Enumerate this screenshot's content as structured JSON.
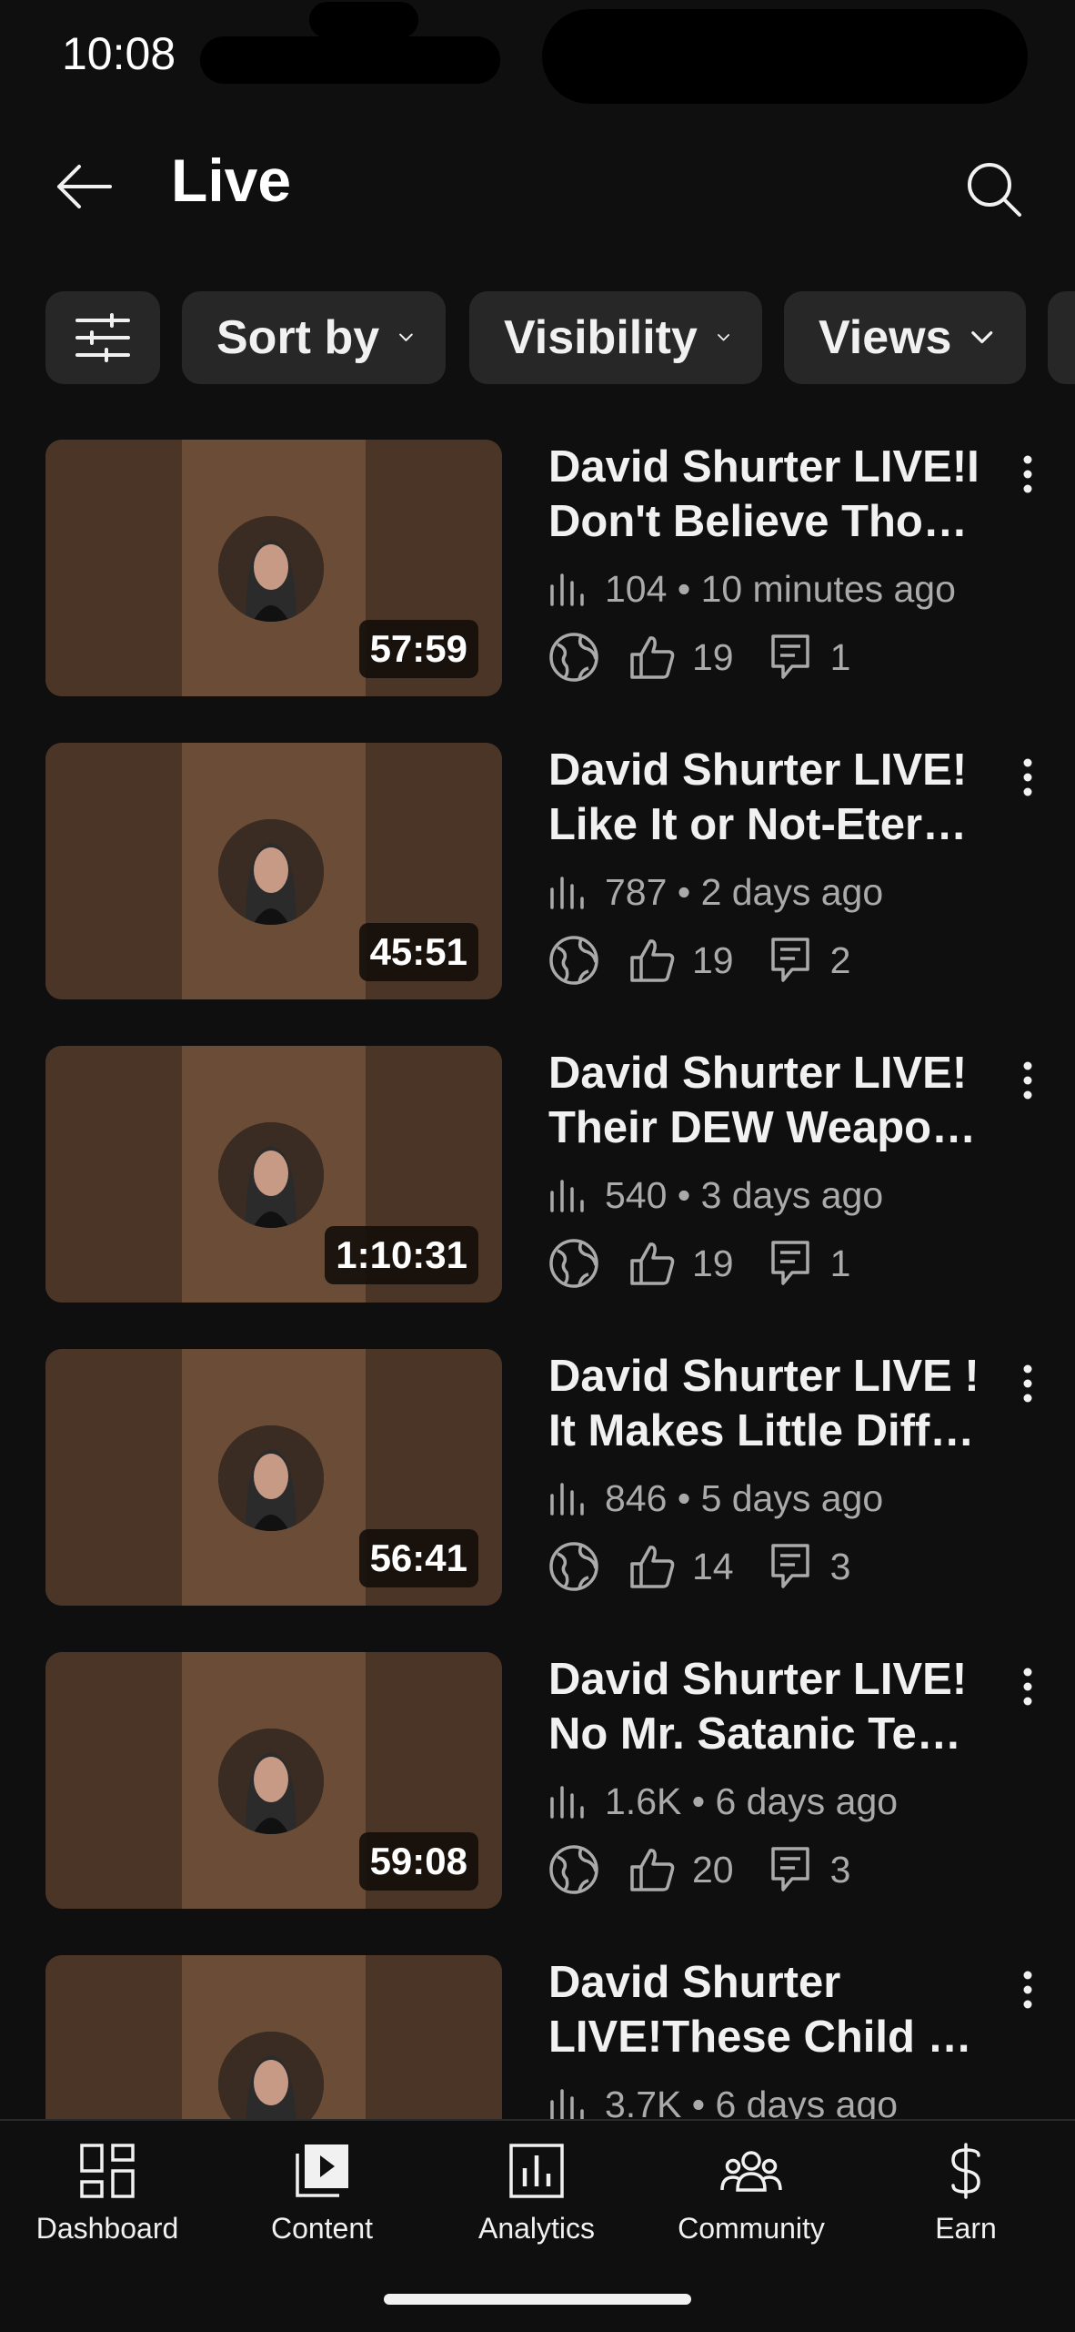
{
  "status_bar": {
    "time": "10:08"
  },
  "header": {
    "title": "Live"
  },
  "filters": {
    "sort_label": "Sort by",
    "visibility_label": "Visibility",
    "views_label": "Views"
  },
  "videos": [
    {
      "title_line1": "David Shurter LIVE!I",
      "title_line2": "Don't Believe Thomas...",
      "duration": "57:59",
      "views": "104",
      "age": "10 minutes ago",
      "likes": "19",
      "comments": "1"
    },
    {
      "title_line1": "David Shurter LIVE!",
      "title_line2": "Like It or Not-Eternity...",
      "duration": "45:51",
      "views": "787",
      "age": "2 days ago",
      "likes": "19",
      "comments": "2"
    },
    {
      "title_line1": "David Shurter LIVE!",
      "title_line2": "Their DEW Weapons...",
      "duration": "1:10:31",
      "views": "540",
      "age": "3 days ago",
      "likes": "19",
      "comments": "1"
    },
    {
      "title_line1": "David Shurter LIVE !",
      "title_line2": "It Makes Little Difference...",
      "duration": "56:41",
      "views": "846",
      "age": "5 days ago",
      "likes": "14",
      "comments": "3"
    },
    {
      "title_line1": "David Shurter LIVE!",
      "title_line2": "No Mr. Satanic Temple...",
      "duration": "59:08",
      "views": "1.6K",
      "age": "6 days ago",
      "likes": "20",
      "comments": "3"
    },
    {
      "title_line1": "David Shurter",
      "title_line2": "LIVE!These Child Predators...",
      "duration": "",
      "views": "3.7K",
      "age": "6 days ago",
      "likes": "",
      "comments": ""
    }
  ],
  "bottom_nav": {
    "dashboard": "Dashboard",
    "content": "Content",
    "analytics": "Analytics",
    "community": "Community",
    "earn": "Earn"
  }
}
